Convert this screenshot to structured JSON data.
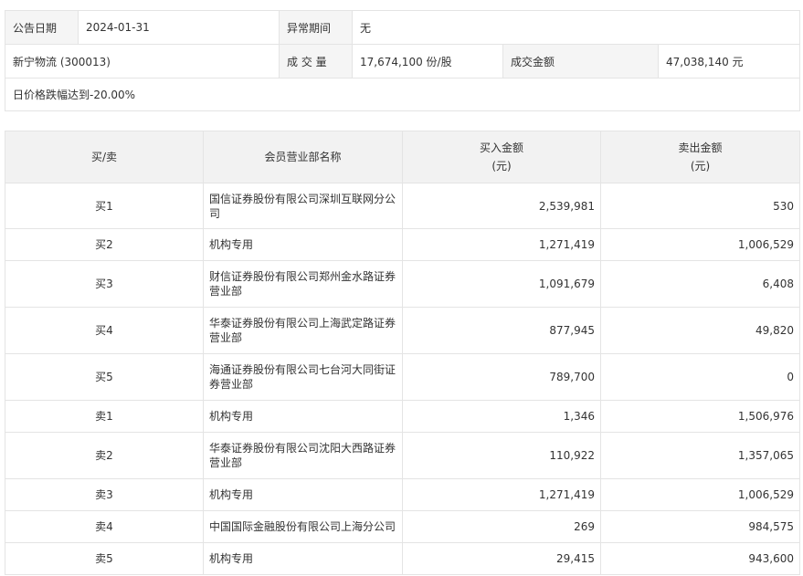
{
  "summary": {
    "announce_date_label": "公告日期",
    "announce_date": "2024-01-31",
    "abnormal_period_label": "异常期间",
    "abnormal_period": "无",
    "stock": "新宁物流 (300013)",
    "volume_label": "成 交 量",
    "volume": "17,674,100 份/股",
    "amount_label": "成交金额",
    "amount": "47,038,140 元",
    "reason": "日价格跌幅达到-20.00%"
  },
  "table": {
    "headers": {
      "side": "买/卖",
      "dept_name": "会员营业部名称",
      "buy_amount": "买入金额",
      "buy_unit": "(元)",
      "sell_amount": "卖出金额",
      "sell_unit": "(元)"
    },
    "rows": [
      {
        "side": "买1",
        "name": "国信证券股份有限公司深圳互联网分公司",
        "buy": "2,539,981",
        "sell": "530"
      },
      {
        "side": "买2",
        "name": "机构专用",
        "buy": "1,271,419",
        "sell": "1,006,529"
      },
      {
        "side": "买3",
        "name": "财信证券股份有限公司郑州金水路证券营业部",
        "buy": "1,091,679",
        "sell": "6,408"
      },
      {
        "side": "买4",
        "name": "华泰证券股份有限公司上海武定路证券营业部",
        "buy": "877,945",
        "sell": "49,820"
      },
      {
        "side": "买5",
        "name": "海通证券股份有限公司七台河大同街证券营业部",
        "buy": "789,700",
        "sell": "0"
      },
      {
        "side": "卖1",
        "name": "机构专用",
        "buy": "1,346",
        "sell": "1,506,976"
      },
      {
        "side": "卖2",
        "name": "华泰证券股份有限公司沈阳大西路证券营业部",
        "buy": "110,922",
        "sell": "1,357,065"
      },
      {
        "side": "卖3",
        "name": "机构专用",
        "buy": "1,271,419",
        "sell": "1,006,529"
      },
      {
        "side": "卖4",
        "name": "中国国际金融股份有限公司上海分公司",
        "buy": "269",
        "sell": "984,575"
      },
      {
        "side": "卖5",
        "name": "机构专用",
        "buy": "29,415",
        "sell": "943,600"
      }
    ]
  }
}
